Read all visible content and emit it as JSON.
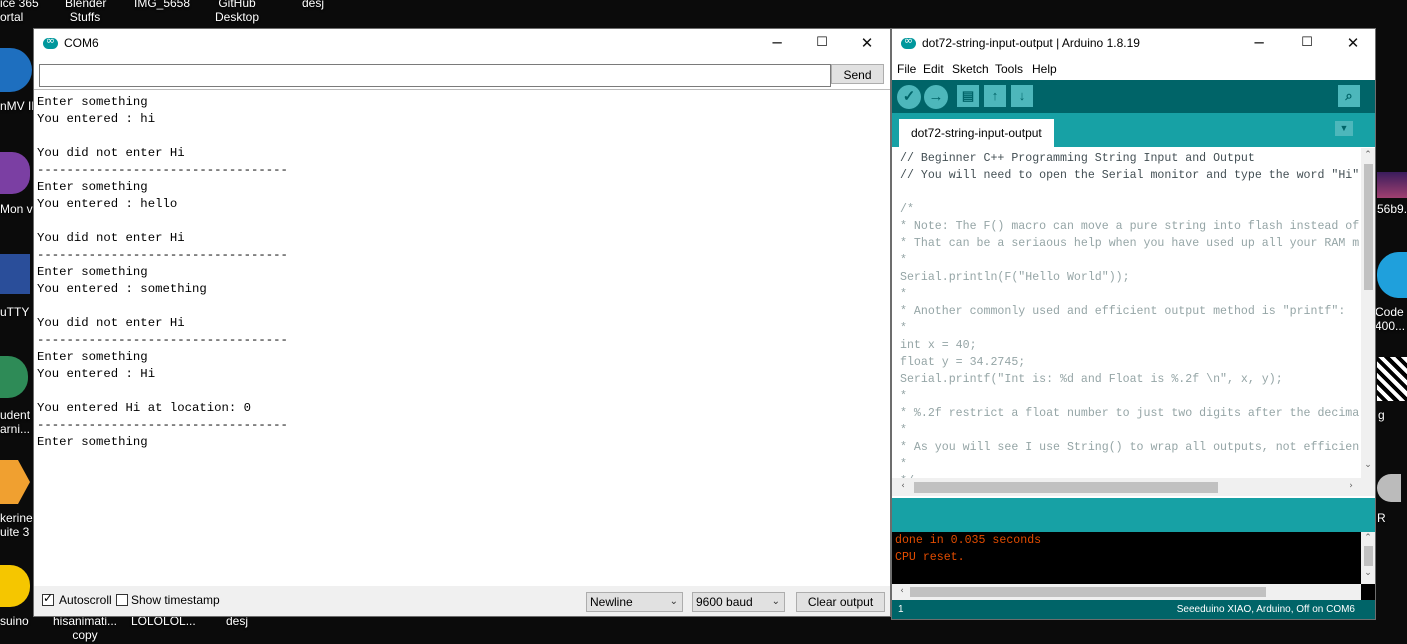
{
  "desktop": {
    "icons": [
      {
        "label": "ice 365\nortal"
      },
      {
        "label": "Blender\nStuffs"
      },
      {
        "label": "IMG_5658"
      },
      {
        "label": "GitHub\nDesktop"
      },
      {
        "label": "desj"
      },
      {
        "label": "nMV ID"
      },
      {
        "label": "Mon v"
      },
      {
        "label": "uTTY"
      },
      {
        "label": "udent\narni..."
      },
      {
        "label": "kerine\nuite 3"
      },
      {
        "label": "suino"
      },
      {
        "label": "hisanimati...\ncopy"
      },
      {
        "label": "LOLOLOL..."
      },
      {
        "label": "desj"
      },
      {
        "label": "56b9..."
      },
      {
        "label": "Code\n400..."
      },
      {
        "label": "g"
      },
      {
        "label": "R"
      }
    ]
  },
  "serial_monitor": {
    "title": "COM6",
    "input_value": "",
    "send_label": "Send",
    "output": "Enter something\nYou entered : hi\n\nYou did not enter Hi\n----------------------------------\nEnter something\nYou entered : hello\n\nYou did not enter Hi\n----------------------------------\nEnter something\nYou entered : something\n\nYou did not enter Hi\n----------------------------------\nEnter something\nYou entered : Hi\n\nYou entered Hi at location: 0\n----------------------------------\nEnter something",
    "autoscroll_label": "Autoscroll",
    "autoscroll_checked": true,
    "timestamp_label": "Show timestamp",
    "timestamp_checked": false,
    "line_ending": "Newline",
    "baud": "9600 baud",
    "clear_label": "Clear output"
  },
  "ide": {
    "title": "dot72-string-input-output | Arduino 1.8.19",
    "menu": [
      "File",
      "Edit",
      "Sketch",
      "Tools",
      "Help"
    ],
    "toolbar": {
      "verify": "verify-icon",
      "upload": "upload-icon",
      "new": "new-icon",
      "open": "open-icon",
      "save": "save-icon",
      "serial_monitor": "serial-monitor-icon"
    },
    "tab_label": "dot72-string-input-output",
    "code": [
      {
        "text": "// Beginner C++ Programming String Input and Output",
        "dim": false
      },
      {
        "text": "// You will need to open the Serial monitor and type the word \"Hi\"",
        "dim": false
      },
      {
        "text": "",
        "dim": false
      },
      {
        "text": "/*",
        "dim": true
      },
      {
        "text": "* Note: The F() macro can move a pure string into flash instead of",
        "dim": true
      },
      {
        "text": "* That can be a seriaous help when you have used up all your RAM m",
        "dim": true
      },
      {
        "text": "*",
        "dim": true
      },
      {
        "text": "Serial.println(F(\"Hello World\"));",
        "dim": true
      },
      {
        "text": "*",
        "dim": true
      },
      {
        "text": "* Another commonly used and efficient output method is \"printf\":",
        "dim": true
      },
      {
        "text": "*",
        "dim": true
      },
      {
        "text": "int x = 40;",
        "dim": true
      },
      {
        "text": "float y = 34.2745;",
        "dim": true
      },
      {
        "text": "Serial.printf(\"Int is: %d and Float is %.2f \\n\", x, y);",
        "dim": true
      },
      {
        "text": "*",
        "dim": true
      },
      {
        "text": "* %.2f restrict a float number to just two digits after the decima",
        "dim": true
      },
      {
        "text": "*",
        "dim": true
      },
      {
        "text": "* As you will see I use String() to wrap all outputs, not efficien",
        "dim": true
      },
      {
        "text": "*",
        "dim": true
      },
      {
        "text": "*/",
        "dim": true
      }
    ],
    "console": [
      "done in 0.035 seconds",
      "CPU reset."
    ],
    "footer_line": "1",
    "footer_board": "Seeeduino XIAO, Arduino, Off on COM6"
  }
}
